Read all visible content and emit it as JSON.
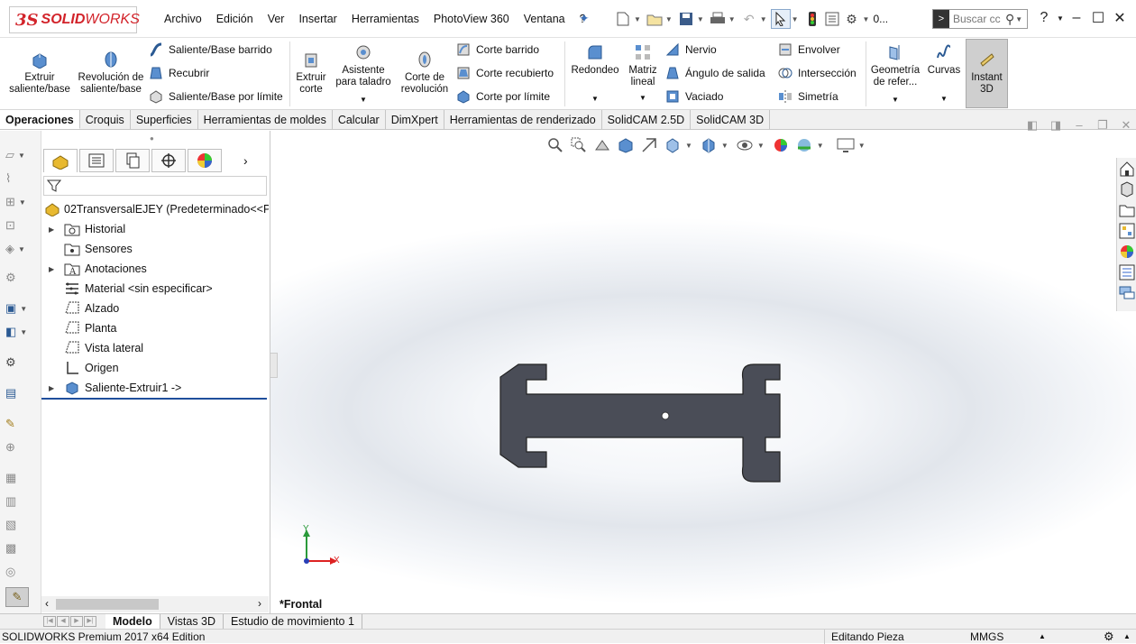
{
  "app": {
    "logo_ds": "3S",
    "logo_solid": "SOLID",
    "logo_works": "WORKS",
    "menu": [
      "Archivo",
      "Edición",
      "Ver",
      "Insertar",
      "Herramientas",
      "PhotoView 360",
      "Ventana",
      "?"
    ],
    "quick_access_extra": "0...",
    "search_placeholder": "Buscar cc",
    "help": "?"
  },
  "ribbon": {
    "extrude": "Extruir saliente/base",
    "revolve": "Revolución de saliente/base",
    "sweep": "Saliente/Base barrido",
    "loft": "Recubrir",
    "boundary": "Saliente/Base por límite",
    "extrude_cut": "Extruir corte",
    "hole_wizard": "Asistente para taladro",
    "revolve_cut": "Corte de revolución",
    "swept_cut": "Corte barrido",
    "lofted_cut": "Corte recubierto",
    "boundary_cut": "Corte por límite",
    "fillet": "Redondeo",
    "pattern": "Matriz lineal",
    "rib": "Nervio",
    "draft": "Ángulo de salida",
    "shell": "Vaciado",
    "wrap": "Envolver",
    "intersect": "Intersección",
    "mirror": "Simetría",
    "ref_geometry": "Geometría de refer...",
    "curves": "Curvas",
    "instant3d": "Instant 3D"
  },
  "command_tabs": [
    "Operaciones",
    "Croquis",
    "Superficies",
    "Herramientas de moldes",
    "Calcular",
    "DimXpert",
    "Herramientas de renderizado",
    "SolidCAM 2.5D",
    "SolidCAM 3D"
  ],
  "tree": {
    "root": "02TransversalEJEY  (Predeterminado<<Pred",
    "items": [
      "Historial",
      "Sensores",
      "Anotaciones",
      "Material <sin especificar>",
      "Alzado",
      "Planta",
      "Vista lateral",
      "Origen",
      "Saliente-Extruir1 ->"
    ]
  },
  "viewport": {
    "view_name": "*Frontal",
    "axis_y": "Y",
    "axis_x": "X",
    "part_color": "#4a4d57"
  },
  "bottom_tabs": [
    "Modelo",
    "Vistas 3D",
    "Estudio de movimiento 1"
  ],
  "status": {
    "edition": "SOLIDWORKS Premium 2017 x64 Edition",
    "mode": "Editando Pieza",
    "units": "MMGS"
  }
}
